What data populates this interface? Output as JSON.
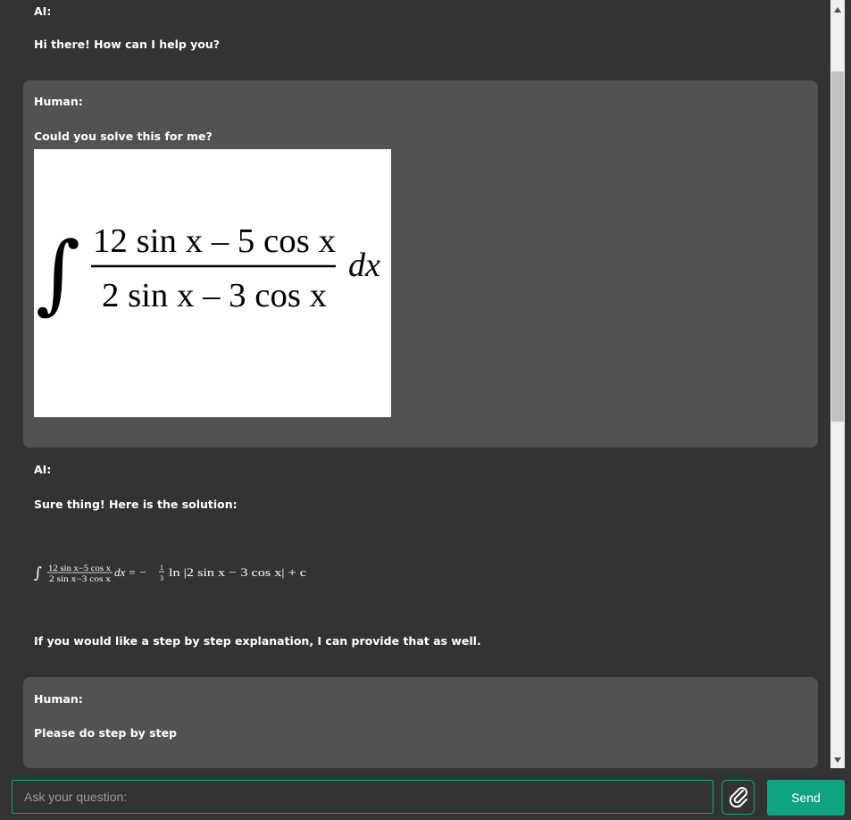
{
  "messages": [
    {
      "speaker": "AI:",
      "text": "Hi there! How can I help you?"
    },
    {
      "speaker": "Human:",
      "text": "Could you solve this for me?"
    },
    {
      "speaker": "AI:",
      "text": "Sure thing! Here is the solution:",
      "followup": "If you would like a step by step explanation, I can provide that as well."
    },
    {
      "speaker": "Human:",
      "text": "Please do step by step"
    }
  ],
  "equation_image": {
    "integral": "∫",
    "numerator": "12 sin x – 5 cos x",
    "denominator": "2 sin x – 3 cos x",
    "differential": "dx"
  },
  "solution_math": {
    "integral": "∫",
    "numerator": "12 sin x−5 cos x",
    "denominator": "2 sin x−3 cos x",
    "rhs_start": "dx = −",
    "frac_num": "1",
    "frac_den": "3",
    "rhs_end": "ln |2 sin x − 3 cos x| + c"
  },
  "input": {
    "placeholder": "Ask your question:",
    "value": ""
  },
  "send_label": "Send",
  "icons": {
    "attach": "paperclip-icon",
    "scroll_up": "triangle-up-icon",
    "scroll_down": "triangle-down-icon"
  },
  "colors": {
    "background": "#333333",
    "human_bubble": "#525252",
    "accent": "#10a37f",
    "text": "#ffffff"
  }
}
